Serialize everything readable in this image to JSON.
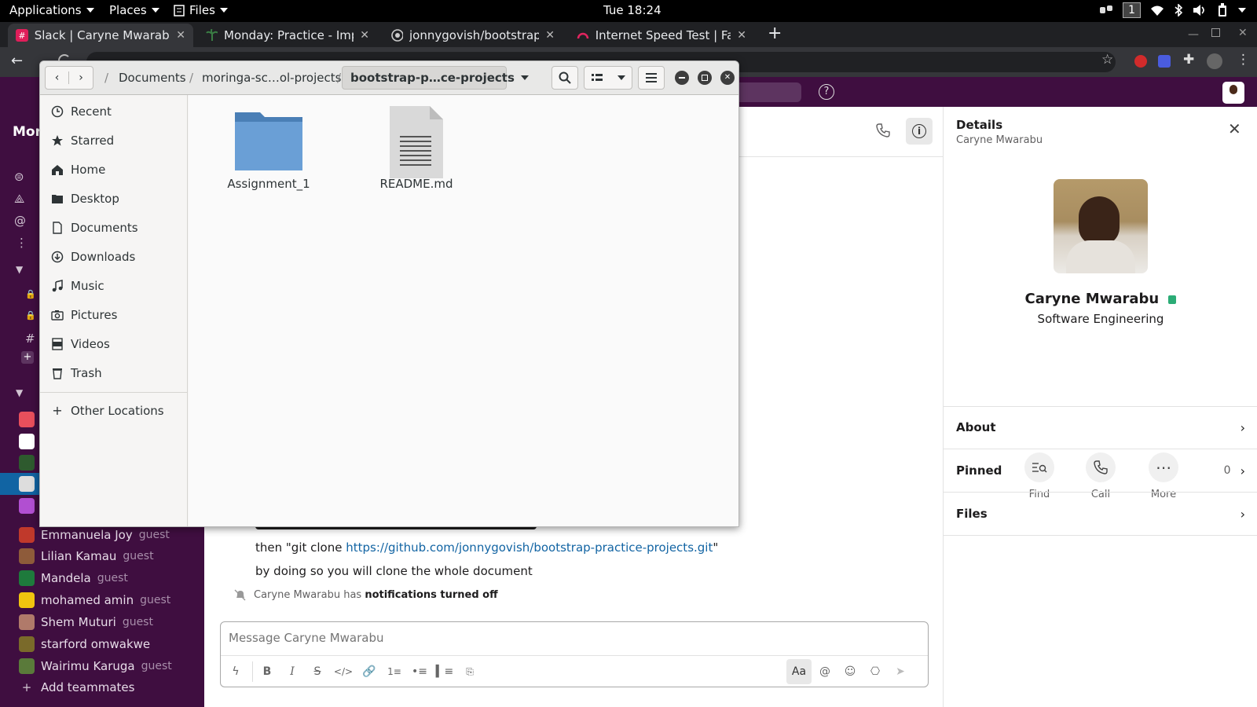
{
  "topbar": {
    "applications": "Applications",
    "places": "Places",
    "files": "Files",
    "clock": "Tue 18:24",
    "workspace": "1"
  },
  "browser": {
    "tabs": [
      {
        "title": "Slack | Caryne Mwarabu |",
        "icon": "slack-icon"
      },
      {
        "title": "Monday: Practice - Implem",
        "icon": "palm-icon"
      },
      {
        "title": "jonnygovish/bootstrap-pr",
        "icon": "github-icon"
      },
      {
        "title": "Internet Speed Test | Fast",
        "icon": "speedometer-icon"
      }
    ]
  },
  "nautilus": {
    "breadcrumb": [
      "Documents",
      "moringa-sc…ol-projects",
      "bootstrap-p…ce-projects"
    ],
    "places": [
      "Recent",
      "Starred",
      "Home",
      "Desktop",
      "Documents",
      "Downloads",
      "Music",
      "Pictures",
      "Videos",
      "Trash"
    ],
    "other_locations": "Other Locations",
    "files": [
      {
        "name": "Assignment_1",
        "type": "folder"
      },
      {
        "name": "README.md",
        "type": "text-file"
      }
    ]
  },
  "slack": {
    "dm_list": [
      {
        "name": "Emmanuela Joy",
        "tag": "guest",
        "color": "#c0392b"
      },
      {
        "name": "Lilian Kamau",
        "tag": "guest",
        "color": "#8e5b3a"
      },
      {
        "name": "Mandela",
        "tag": "guest",
        "color": "#1e7a3c"
      },
      {
        "name": "mohamed amin",
        "tag": "guest",
        "color": "#f1c40f"
      },
      {
        "name": "Shem Muturi",
        "tag": "guest",
        "color": "#b07a6a"
      },
      {
        "name": "starford omwakwe",
        "tag": "",
        "color": "#7a6a2a"
      },
      {
        "name": "Wairimu Karuga",
        "tag": "guest",
        "color": "#5a7a3a"
      }
    ],
    "add_teammates": "Add teammates",
    "messages": {
      "clone_prefix": "then \"git clone ",
      "clone_link": "https://github.com/jonnygovish/bootstrap-practice-projects.git",
      "clone_suffix": "\"",
      "clone_note": "by doing so you will clone the whole document",
      "notif_name": "Caryne Mwarabu has ",
      "notif_bold": "notifications turned off"
    },
    "composer_placeholder": "Message Caryne Mwarabu",
    "composer_aa": "Aa",
    "details": {
      "title": "Details",
      "subtitle": "Caryne Mwarabu",
      "name": "Caryne Mwarabu",
      "role": "Software Engineering",
      "actions": [
        "Find",
        "Call",
        "More"
      ],
      "rows": [
        {
          "label": "About",
          "count": ""
        },
        {
          "label": "Pinned",
          "count": "0"
        },
        {
          "label": "Files",
          "count": ""
        }
      ]
    }
  },
  "colors": {
    "slack_sidebar": "#3f0e40",
    "folder_blue": "#5a8fc6",
    "link_blue": "#1264a3"
  }
}
